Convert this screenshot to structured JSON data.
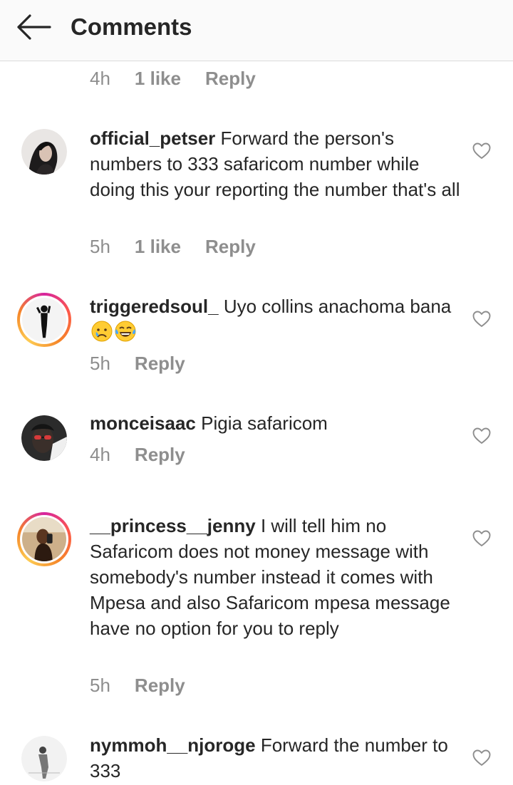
{
  "header": {
    "title": "Comments"
  },
  "top_meta": {
    "time": "4h",
    "likes": "1 like",
    "reply": "Reply"
  },
  "comments": [
    {
      "username": "official_petser",
      "text": "Forward the person's numbers to 333 safaricom number while doing this your reporting the number that's all",
      "time": "5h",
      "likes": "1 like",
      "reply": "Reply"
    },
    {
      "username": "triggeredsoul_",
      "text": "Uyo collins anachoma bana",
      "emojis": [
        "crying-face",
        "tears-of-joy-face"
      ],
      "time": "5h",
      "reply": "Reply"
    },
    {
      "username": "monceisaac",
      "text": "Pigia safaricom",
      "time": "4h",
      "reply": "Reply"
    },
    {
      "username": "__princess__jenny",
      "text": "I will tell him no Safaricom does not money message with somebody's number instead it comes with Mpesa and also Safaricom mpesa message have no option for you to reply",
      "time": "5h",
      "reply": "Reply"
    },
    {
      "username": "nymmoh__njoroge",
      "text": "Forward the number to 333"
    }
  ],
  "icons": {
    "back": "arrow-left-icon",
    "like": "heart-outline-icon"
  },
  "colors": {
    "text": "#262626",
    "muted": "#8e8e8e",
    "header_bg": "#fafafa",
    "divider": "#dbdbdb"
  }
}
